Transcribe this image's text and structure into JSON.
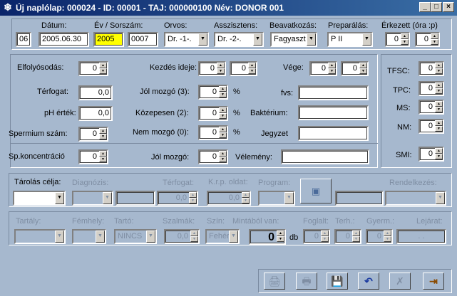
{
  "window": {
    "title": "Új naplólap: 000024 - ID: 00001 - TAJ: 000000100  Név: DONOR 001",
    "minimize": "_",
    "maximize": "□",
    "close": "×"
  },
  "header": {
    "datum_label": "Dátum:",
    "datum_prefix": "06",
    "datum_value": "2005.06.30",
    "ev_label": "Év / Sorszám:",
    "ev_value": "2005",
    "sorszam_value": "0007",
    "orvos_label": "Orvos:",
    "orvos_value": "Dr. -1-.",
    "asszisztens_label": "Asszisztens:",
    "asszisztens_value": "Dr. -2-.",
    "beavatkozas_label": "Beavatkozás:",
    "beavatkozas_value": "Fagyaszt",
    "preparalas_label": "Preparálás:",
    "preparalas_value": "P II",
    "erkezett_label": "Érkezett (óra :p)",
    "erkezett_ora": "0",
    "erkezett_perc": "0"
  },
  "main": {
    "elfolyosodas_label": "Elfolyósodás:",
    "elfolyosodas_value": "0",
    "kezdes_label": "Kezdés ideje:",
    "kezdes_ora": "0",
    "kezdes_perc": "0",
    "vege_label": "Vége:",
    "vege_ora": "0",
    "vege_perc": "0",
    "terfogat_label": "Térfogat:",
    "terfogat_value": "0,0",
    "ph_label": "pH érték:",
    "ph_value": "0,0",
    "spermium_label": "Spermium szám:",
    "spermium_value": "0",
    "jol_mozgo3_label": "Jól mozgó (3):",
    "jol_mozgo3_value": "0",
    "kozepesen_label": "Közepesen (2):",
    "kozepesen_value": "0",
    "nem_mozgo_label": "Nem mozgó (0):",
    "nem_mozgo_value": "0",
    "percent": "%",
    "fvs_label": "fvs:",
    "fvs_value": "",
    "bakterium_label": "Baktérium:",
    "bakterium_value": "",
    "jegyzet_label": "Jegyzet",
    "jegyzet_value": "",
    "spkonc_label": "Sp.koncentráció",
    "spkonc_value": "0",
    "jol_mozgo_label": "Jól mozgó:",
    "jol_mozgo_value": "0",
    "velemeny_label": "Vélemény:",
    "velemeny_value": ""
  },
  "right": {
    "tfsc_label": "TFSC:",
    "tfsc_value": "0",
    "tpc_label": "TPC:",
    "tpc_value": "0",
    "ms_label": "MS:",
    "ms_value": "0",
    "nm_label": "NM:",
    "nm_value": "0",
    "smi_label": "SMI:",
    "smi_value": "0"
  },
  "storage": {
    "tarolas_label": "Tárolás célja:",
    "tarolas_value": "",
    "diagnozis_label": "Diagnózis:",
    "terfogat_label": "Térfogat:",
    "terfogat_value": "0,0",
    "krp_label": "K.r.p. oldat:",
    "krp_value": "0,0",
    "program_label": "Program:",
    "rendelkezes_label": "Rendelkezés:",
    "tartaly_label": "Tartály:",
    "femhely_label": "Fémhely:",
    "tarto_label": "Tartó:",
    "tarto_value": "NINCS",
    "szalmak_label": "Szalmák:",
    "szalmak_value": "0,0",
    "szin_label": "Szín:",
    "szin_value": "Fehér",
    "mintabol_label": "Mintából van:",
    "mintabol_value": "0",
    "db_label": "db",
    "foglalt_label": "Foglalt:",
    "foglalt_value": "0",
    "terh_label": "Terh.:",
    "terh_value": "0",
    "gyerm_label": "Gyerm.:",
    "gyerm_value": "0",
    "lejarat_label": "Lejárat:",
    "lejarat_value": ". ."
  },
  "toolbar": {
    "print_icon": "🖨",
    "print2_icon": "🖶",
    "save_icon": "💾",
    "undo_icon": "↶",
    "delete_icon": "✗",
    "exit_icon": "⇥"
  },
  "colors": {
    "bg": "#a6b8ce",
    "highlight": "#ffff00"
  }
}
